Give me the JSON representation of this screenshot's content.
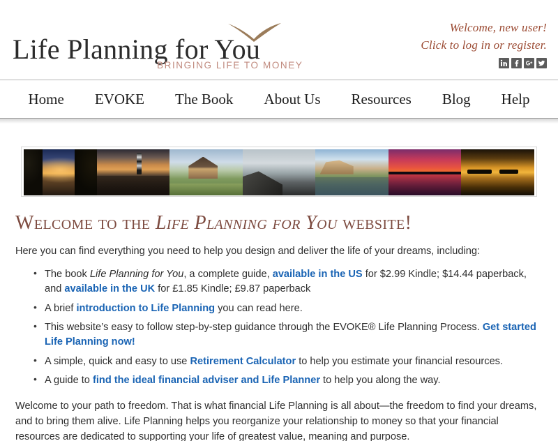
{
  "header": {
    "logo_text": "Life Planning for You",
    "logo_tagline": "BRINGING  LIFE TO MONEY",
    "welcome_line_1": "Welcome, new user!",
    "welcome_line_2": "Click to log in or register.",
    "social": [
      {
        "name": "linkedin-icon",
        "glyph": "in"
      },
      {
        "name": "facebook-icon",
        "glyph": "f"
      },
      {
        "name": "googleplus-icon",
        "glyph": "g+"
      },
      {
        "name": "twitter-icon",
        "glyph": "t"
      }
    ]
  },
  "nav": {
    "items": [
      {
        "label": "Home"
      },
      {
        "label": "EVOKE"
      },
      {
        "label": "The Book"
      },
      {
        "label": "About Us"
      },
      {
        "label": "Resources"
      },
      {
        "label": "Blog"
      },
      {
        "label": "Help"
      }
    ]
  },
  "banner": {
    "photos": [
      {
        "name": "photo-lake-sunset",
        "cls": "ph-lake"
      },
      {
        "name": "photo-lighthouse",
        "cls": "ph-lighthouse"
      },
      {
        "name": "photo-cabin-house",
        "cls": "ph-house"
      },
      {
        "name": "photo-cliff",
        "cls": "ph-cliff"
      },
      {
        "name": "photo-coastal-tidepools",
        "cls": "ph-coast"
      },
      {
        "name": "photo-magenta-sunset",
        "cls": "ph-magenta"
      },
      {
        "name": "photo-golden-sunset",
        "cls": "ph-gold"
      }
    ]
  },
  "main": {
    "heading_part1": "Welcome to the ",
    "heading_italic": "Life Planning for You",
    "heading_part2": " website!",
    "intro": "Here you can find everything you need to help you design and deliver the life of your dreams, including:",
    "bullets": [
      {
        "segments": [
          {
            "t": "The book ",
            "style": "plain"
          },
          {
            "t": "Life Planning for You",
            "style": "italic"
          },
          {
            "t": ", a complete guide, ",
            "style": "plain"
          },
          {
            "t": "available in the US",
            "style": "link"
          },
          {
            "t": " for $2.99 Kindle; $14.44 paperback, and ",
            "style": "plain"
          },
          {
            "t": "available in the UK",
            "style": "link"
          },
          {
            "t": " for £1.85 Kindle; £9.87 paperback",
            "style": "plain"
          }
        ]
      },
      {
        "segments": [
          {
            "t": "A brief ",
            "style": "plain"
          },
          {
            "t": "introduction to Life Planning",
            "style": "link"
          },
          {
            "t": " you can read here.",
            "style": "plain"
          }
        ]
      },
      {
        "segments": [
          {
            "t": "This website’s easy to follow step-by-step guidance through the EVOKE® Life Planning Process. ",
            "style": "plain"
          },
          {
            "t": "Get started Life Planning now!",
            "style": "link"
          }
        ]
      },
      {
        "segments": [
          {
            "t": "A simple, quick and easy to use ",
            "style": "plain"
          },
          {
            "t": "Retirement Calculator",
            "style": "link"
          },
          {
            "t": " to help you estimate your financial resources.",
            "style": "plain"
          }
        ]
      },
      {
        "segments": [
          {
            "t": "A guide to ",
            "style": "plain"
          },
          {
            "t": "find the ideal financial adviser and Life Planner",
            "style": "link"
          },
          {
            "t": " to help you along the way.",
            "style": "plain"
          }
        ]
      }
    ],
    "closing": "Welcome to your path to freedom. That is what financial Life Planning is all about—the freedom to find your dreams, and to bring them alive. Life Planning helps you reorganize your relationship to money so that your financial resources are dedicated to supporting your life of greatest value, meaning and purpose."
  },
  "colors": {
    "heading": "#7d4b40",
    "link": "#1a64b4",
    "tagline": "#c08a7e",
    "welcome": "#9b4a32"
  }
}
